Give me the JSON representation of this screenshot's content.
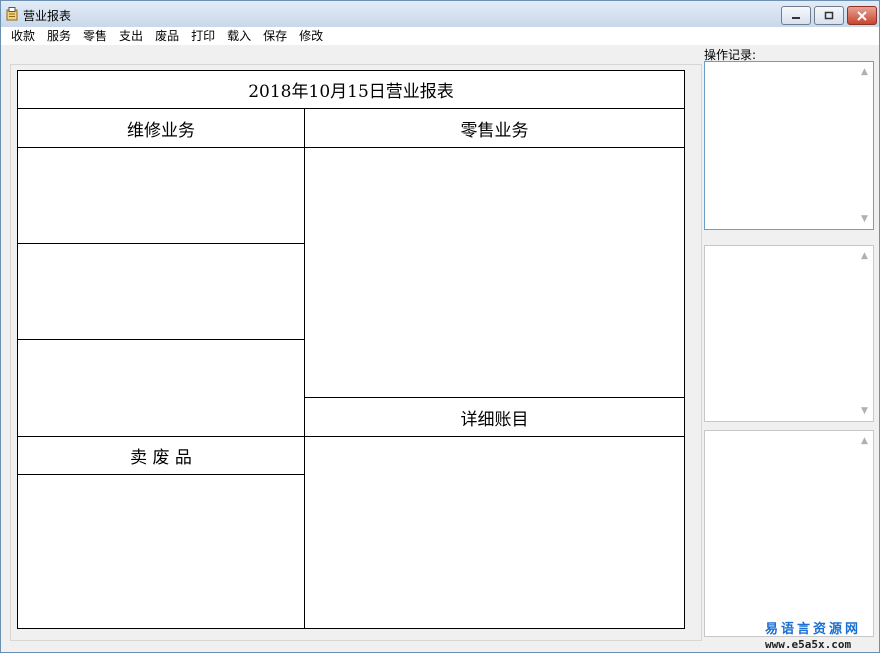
{
  "window": {
    "title": "营业报表"
  },
  "menu": [
    "收款",
    "服务",
    "零售",
    "支出",
    "废品",
    "打印",
    "载入",
    "保存",
    "修改"
  ],
  "report": {
    "title": "2018年10月15日营业报表",
    "repair_header": "维修业务",
    "retail_header": "零售业务",
    "scrap_header": "卖 废 品",
    "detail_header": "详细账目"
  },
  "log": {
    "label": "操作记录:"
  },
  "watermark": {
    "cn": "易语言资源网",
    "url": "www.e5a5x.com"
  },
  "colors": {
    "title_gradient_top": "#e3ecf7",
    "close_button": "#c8452e",
    "watermark": "#1a6fd0"
  }
}
